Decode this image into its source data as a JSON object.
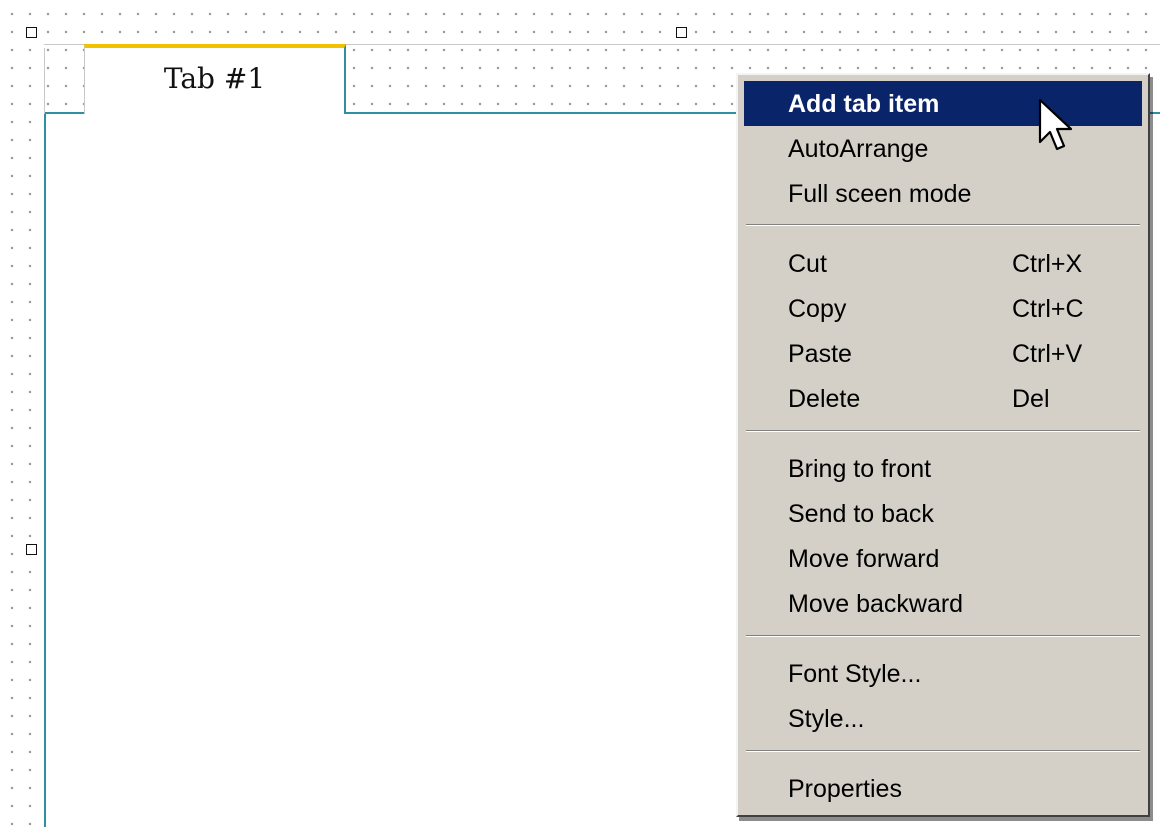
{
  "tab": {
    "label": "Tab #1"
  },
  "menu": {
    "items": [
      {
        "label": "Add tab item",
        "shortcut": ""
      },
      {
        "label": "AutoArrange",
        "shortcut": ""
      },
      {
        "label": "Full sceen mode",
        "shortcut": ""
      },
      {
        "label": "Cut",
        "shortcut": "Ctrl+X"
      },
      {
        "label": "Copy",
        "shortcut": "Ctrl+C"
      },
      {
        "label": "Paste",
        "shortcut": "Ctrl+V"
      },
      {
        "label": "Delete",
        "shortcut": "Del"
      },
      {
        "label": "Bring to front",
        "shortcut": ""
      },
      {
        "label": "Send to back",
        "shortcut": ""
      },
      {
        "label": "Move forward",
        "shortcut": ""
      },
      {
        "label": "Move backward",
        "shortcut": ""
      },
      {
        "label": "Font Style...",
        "shortcut": ""
      },
      {
        "label": "Style...",
        "shortcut": ""
      },
      {
        "label": "Properties",
        "shortcut": ""
      }
    ]
  },
  "colors": {
    "highlight": "#0a246a",
    "menu_bg": "#d4d0c8",
    "tab_accent": "#f2c200",
    "tab_border": "#2e8fa3"
  },
  "icons": [
    "selection-handle-icon",
    "mouse-pointer-icon"
  ]
}
